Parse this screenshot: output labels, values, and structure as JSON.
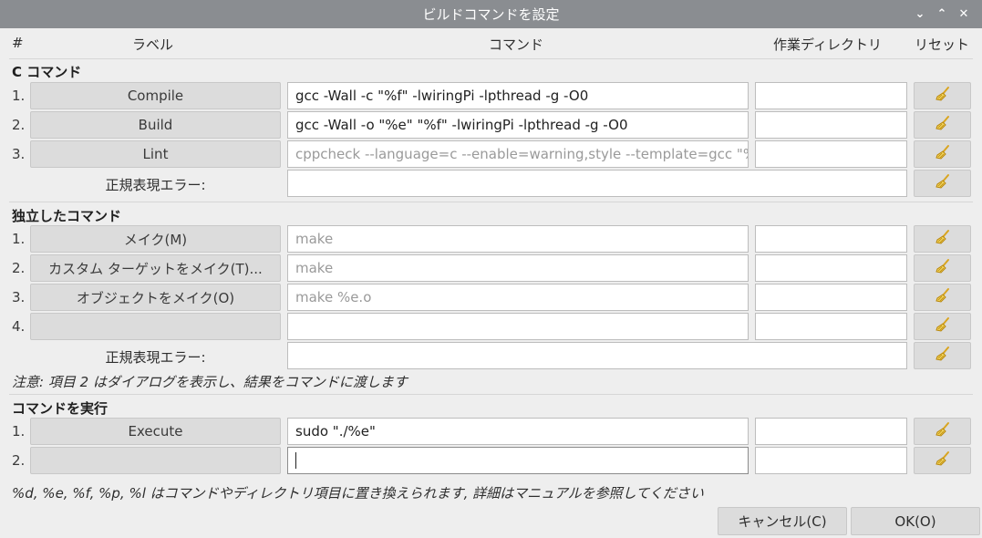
{
  "window": {
    "title": "ビルドコマンドを設定",
    "controls": [
      "⌄",
      "⌃",
      "✕"
    ]
  },
  "headers": {
    "num": "#",
    "label": "ラベル",
    "command": "コマンド",
    "workdir": "作業ディレクトリ",
    "reset": "リセット"
  },
  "c_section": {
    "title": "C コマンド",
    "rows": [
      {
        "num": "1.",
        "label": "Compile",
        "command": "gcc -Wall -c \"%f\" -lwiringPi -lpthread -g -O0"
      },
      {
        "num": "2.",
        "label": "Build",
        "command": "gcc -Wall -o \"%e\" \"%f\" -lwiringPi -lpthread -g -O0"
      },
      {
        "num": "3.",
        "label": "Lint",
        "command": "cppcheck --language=c --enable=warning,style --template=gcc \"%f\""
      }
    ],
    "regex_label": "正規表現エラー:",
    "regex_value": ""
  },
  "indep_section": {
    "title": "独立したコマンド",
    "rows": [
      {
        "num": "1.",
        "label": "メイク(M)",
        "command": "make"
      },
      {
        "num": "2.",
        "label": "カスタム ターゲットをメイク(T)...",
        "command": "make"
      },
      {
        "num": "3.",
        "label": "オブジェクトをメイク(O)",
        "command": "make %e.o"
      },
      {
        "num": "4.",
        "label": "",
        "command": ""
      }
    ],
    "regex_label": "正規表現エラー:",
    "regex_value": ""
  },
  "note1": "注意: 項目 2 はダイアログを表示し、結果をコマンドに渡します",
  "exec_section": {
    "title": "コマンドを実行",
    "rows": [
      {
        "num": "1.",
        "label": "Execute",
        "command": "sudo \"./%e\""
      },
      {
        "num": "2.",
        "label": "",
        "command": ""
      }
    ]
  },
  "note2": "%d, %e, %f, %p, %l はコマンドやディレクトリ項目に置き換えられます, 詳細はマニュアルを参照してください",
  "buttons": {
    "cancel": "キャンセル(C)",
    "ok": "OK(O)"
  },
  "colors": {
    "titlebar": "#8a8d91",
    "background": "#eeeeee",
    "button": "#dcdcdc",
    "broom_handle": "#d9a520"
  },
  "icons": {
    "reset": "broom-icon"
  }
}
